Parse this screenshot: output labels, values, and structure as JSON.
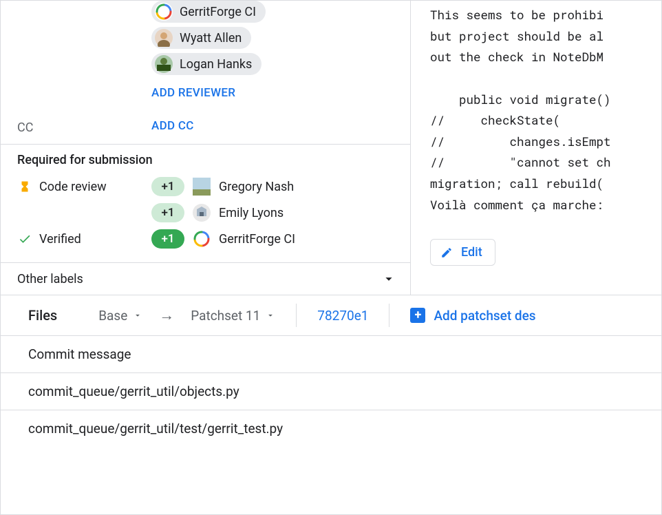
{
  "reviewers": {
    "items": [
      {
        "name": "GerritForge CI",
        "avatar": "gerritforge"
      },
      {
        "name": "Wyatt Allen",
        "avatar": "wyatt"
      },
      {
        "name": "Logan Hanks",
        "avatar": "logan"
      }
    ],
    "add_label": "ADD REVIEWER"
  },
  "cc": {
    "label": "CC",
    "add_label": "ADD CC"
  },
  "submission": {
    "header": "Required for submission",
    "requirements": [
      {
        "name": "Code review",
        "status": "pending",
        "votes": [
          {
            "score": "+1",
            "voter": "Gregory Nash",
            "avatar": "gregory",
            "strong": false
          },
          {
            "score": "+1",
            "voter": "Emily Lyons",
            "avatar": "emily",
            "strong": false
          }
        ]
      },
      {
        "name": "Verified",
        "status": "satisfied",
        "votes": [
          {
            "score": "+1",
            "voter": "GerritForge CI",
            "avatar": "gerritforge",
            "strong": true
          }
        ]
      }
    ],
    "other_labels": "Other labels"
  },
  "commit_message": "This seems to be prohibi\nbut project should be al\nout the check in NoteDbM\n\n    public void migrate()\n//     checkState(\n//         changes.isEmpt\n//         \"cannot set ch\nmigration; call rebuild(\nVoilà comment ça marche:",
  "edit_label": "Edit",
  "files": {
    "title": "Files",
    "base_label": "Base",
    "patchset_label": "Patchset 11",
    "commit_hash": "78270e1",
    "add_patchset_label": "Add patchset des",
    "items": [
      "Commit message",
      "commit_queue/gerrit_util/objects.py",
      "commit_queue/gerrit_util/test/gerrit_test.py"
    ]
  }
}
